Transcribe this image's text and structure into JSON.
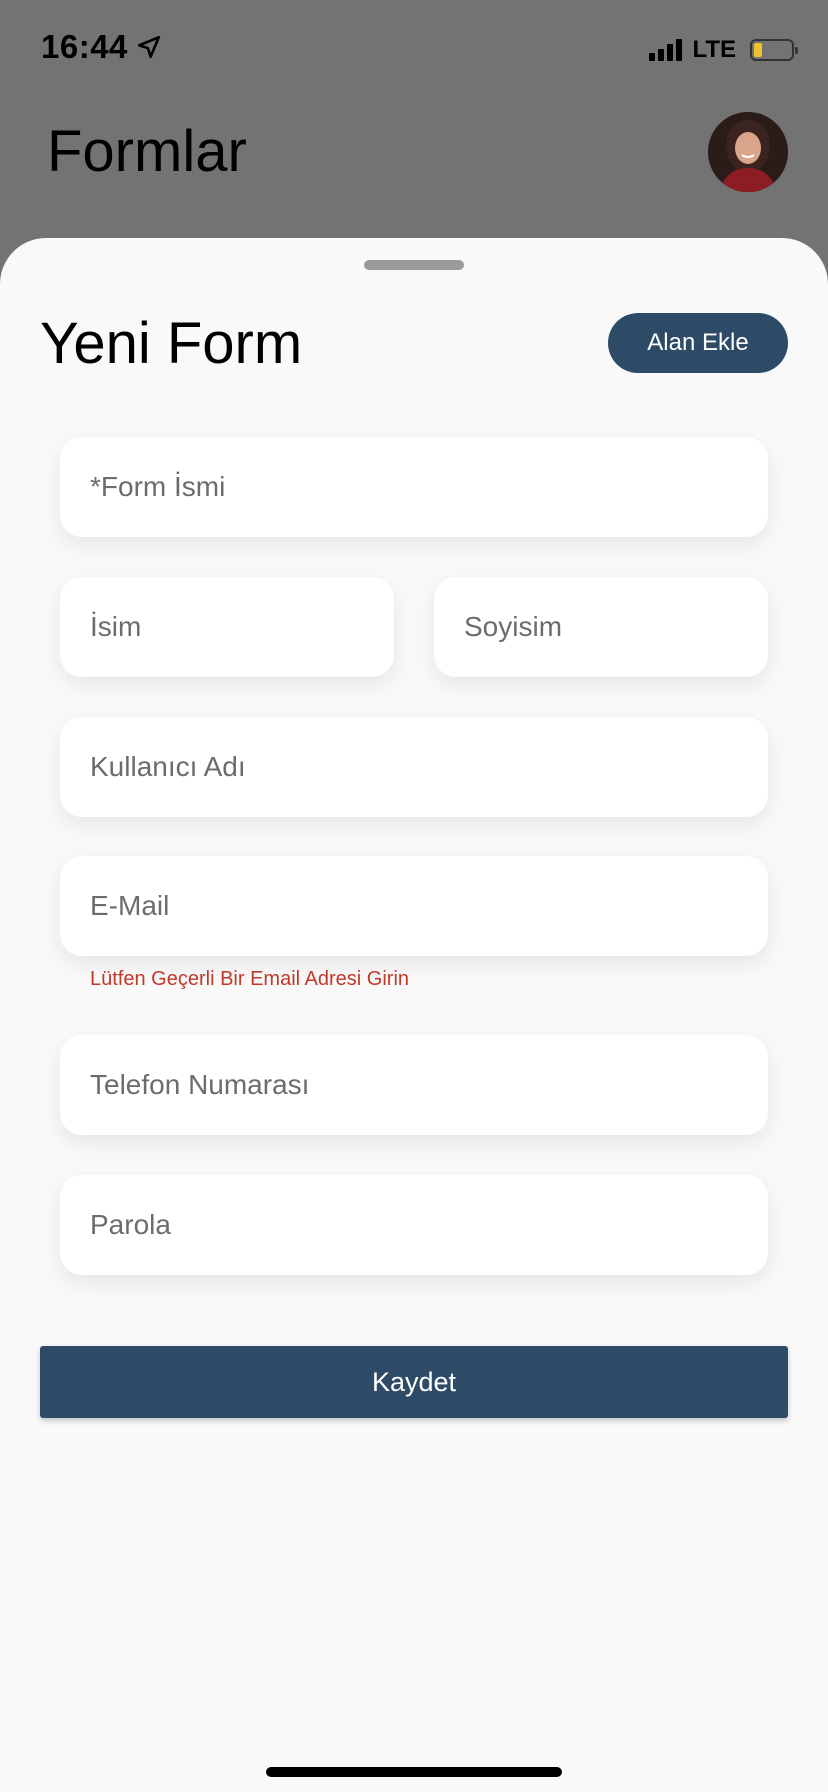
{
  "status_bar": {
    "time": "16:44",
    "network": "LTE",
    "battery_color": "#f2c12e"
  },
  "background": {
    "title": "Formlar"
  },
  "sheet": {
    "title": "Yeni Form",
    "add_field_label": "Alan Ekle",
    "fields": {
      "form_name": {
        "placeholder": "*Form İsmi",
        "value": ""
      },
      "first_name": {
        "placeholder": "İsim",
        "value": ""
      },
      "last_name": {
        "placeholder": "Soyisim",
        "value": ""
      },
      "username": {
        "placeholder": "Kullanıcı Adı",
        "value": ""
      },
      "email": {
        "placeholder": "E-Mail",
        "value": ""
      },
      "phone": {
        "placeholder": "Telefon Numarası",
        "value": ""
      },
      "password": {
        "placeholder": "Parola",
        "value": ""
      }
    },
    "email_error": "Lütfen Geçerli Bir Email Adresi Girin",
    "save_label": "Kaydet"
  },
  "colors": {
    "primary": "#2d4a67",
    "error": "#c0392b",
    "sheet_background": "#f9f9f9",
    "dimmed_background": "#737373"
  },
  "icons": {
    "location": "location-arrow-icon",
    "signal": "cellular-signal-icon",
    "battery": "battery-icon"
  }
}
